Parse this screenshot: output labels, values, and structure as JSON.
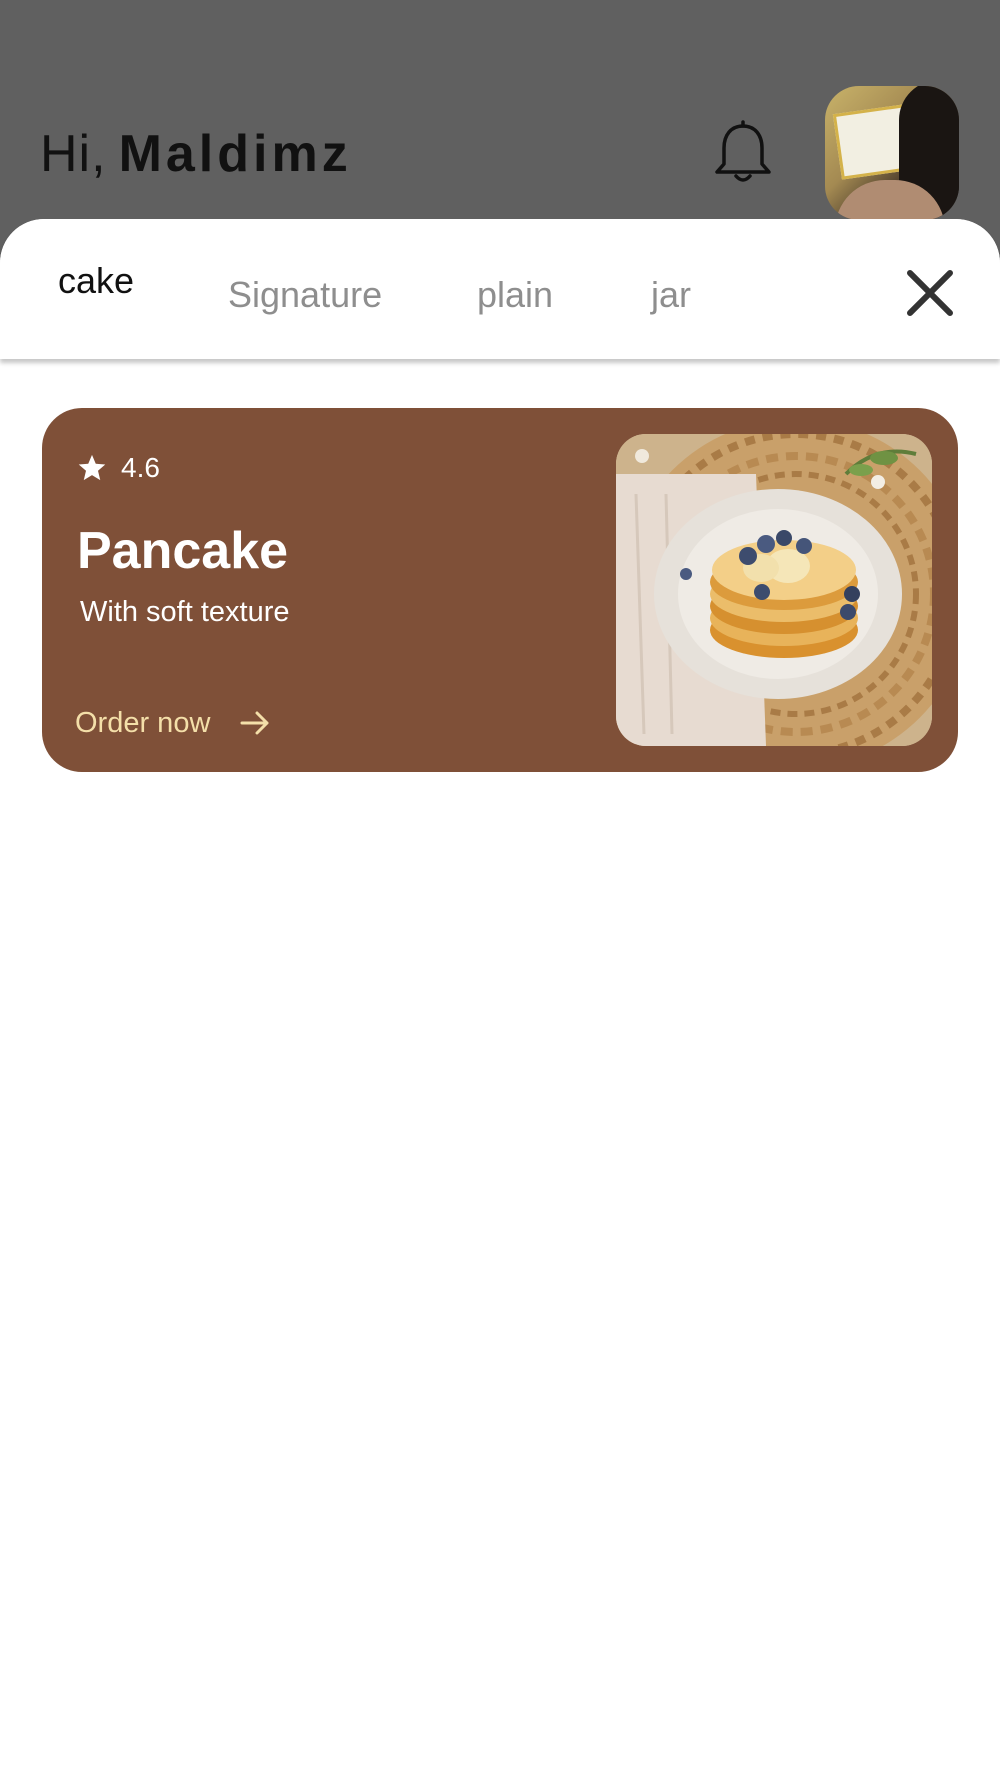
{
  "header": {
    "greeting": "Hi,",
    "username": "Maldimz"
  },
  "tabs": [
    {
      "label": "cake",
      "active": true
    },
    {
      "label": "Signature",
      "active": false
    },
    {
      "label": "plain",
      "active": false
    },
    {
      "label": "jar",
      "active": false
    }
  ],
  "card": {
    "rating": "4.6",
    "title": "Pancake",
    "subtitle": "With soft texture",
    "cta": "Order now",
    "colors": {
      "background": "#7f5038",
      "cta": "#f4dfa9"
    }
  },
  "icons": [
    "bell-icon",
    "close-icon",
    "star-icon",
    "arrow-right-icon"
  ],
  "colors": {
    "backdrop": "#606060",
    "accent": "#7f5038"
  }
}
